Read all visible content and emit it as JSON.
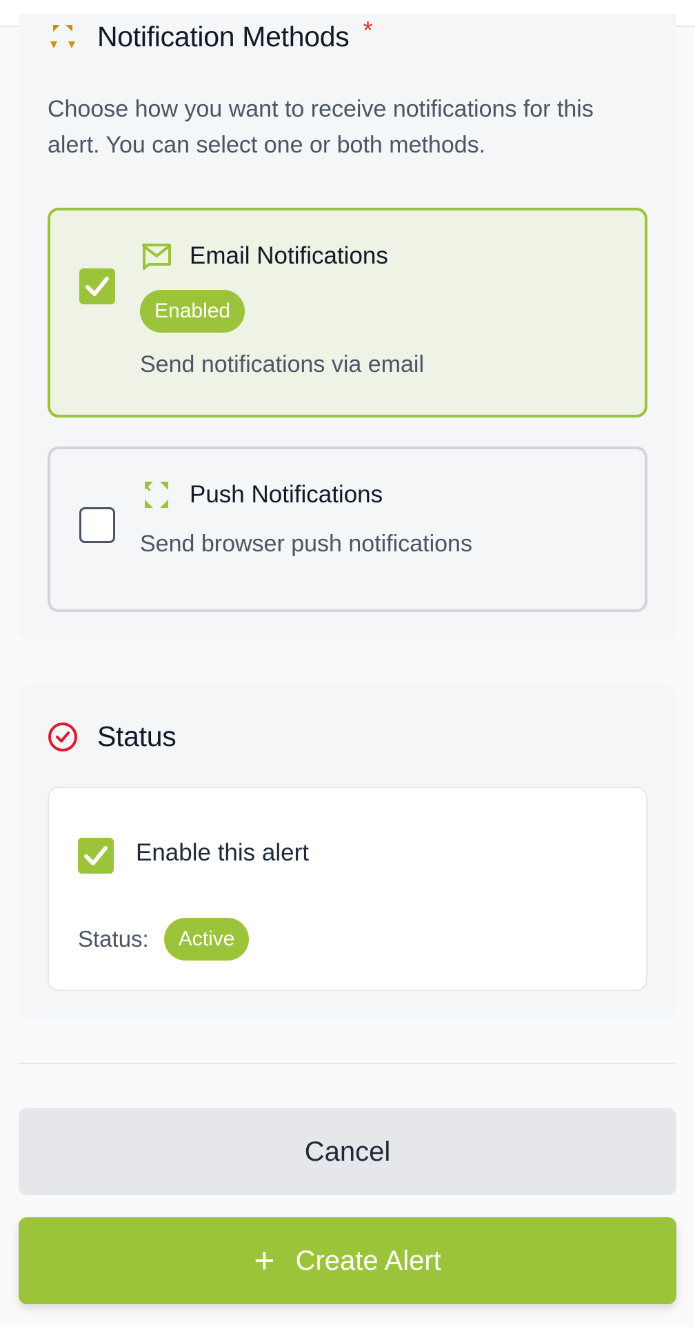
{
  "notification_methods": {
    "title": "Notification Methods",
    "required_marker": "*",
    "description": "Choose how you want to receive notifications for this alert. You can select one or both methods.",
    "email": {
      "title": "Email Notifications",
      "badge": "Enabled",
      "description": "Send notifications via email",
      "checked": true
    },
    "push": {
      "title": "Push Notifications",
      "description": "Send browser push notifications",
      "checked": false
    }
  },
  "status": {
    "title": "Status",
    "enable_label": "Enable this alert",
    "enabled": true,
    "status_label": "Status:",
    "status_value": "Active"
  },
  "actions": {
    "cancel_label": "Cancel",
    "create_label": "Create Alert",
    "create_icon": "plus-icon"
  },
  "colors": {
    "accent": "#9bc43a",
    "required": "#ef2b2b",
    "status_icon": "#dc1c2c",
    "notif_icon": "#d98a12"
  }
}
